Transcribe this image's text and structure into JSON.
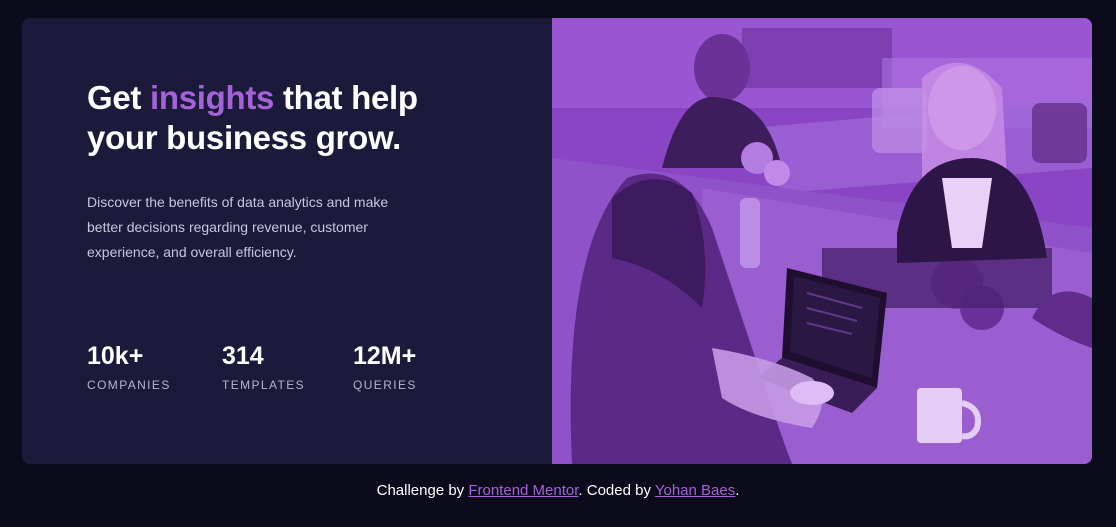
{
  "hero": {
    "headline_before": "Get ",
    "headline_accent": "insights",
    "headline_after": " that help your business grow.",
    "description": "Discover the benefits of data analytics and make better decisions regarding revenue, customer experience, and overall efficiency."
  },
  "stats": [
    {
      "value": "10k+",
      "label": "Companies"
    },
    {
      "value": "314",
      "label": "Templates"
    },
    {
      "value": "12M+",
      "label": "Queries"
    }
  ],
  "footer": {
    "prefix": "Challenge by ",
    "link1": "Frontend Mentor",
    "middle": ". Coded by ",
    "link2": "Yohan Baes",
    "suffix": "."
  },
  "colors": {
    "background": "#0b0b1c",
    "card": "#1b1a3b",
    "accent": "#a562d9",
    "photo_overlay": "#8c44c8"
  }
}
